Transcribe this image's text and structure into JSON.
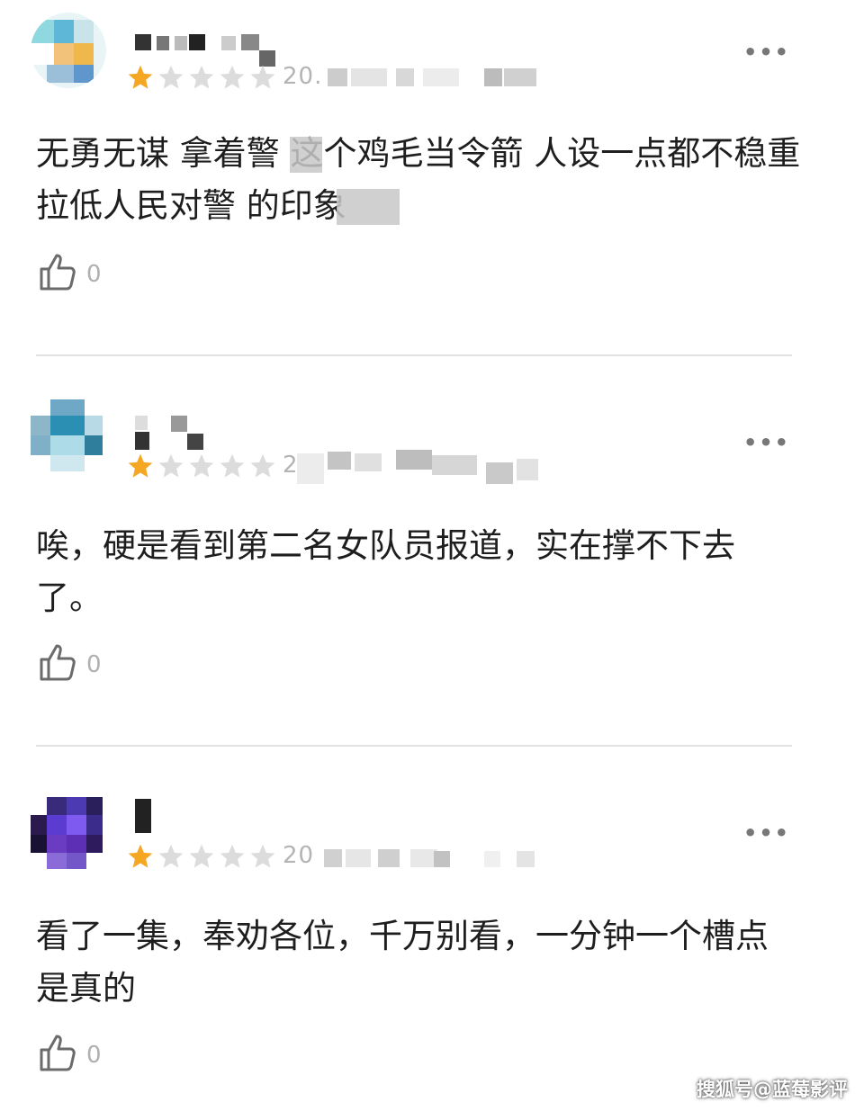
{
  "reviews": [
    {
      "rating": 1,
      "date_prefix": "20.",
      "content": "无勇无谋 拿着警  这个鸡毛当令箭 人设一点都不稳重 拉低人民对警  的印象",
      "likes": "0",
      "more": "•••"
    },
    {
      "rating": 1,
      "date_prefix": "2",
      "content": "唉，硬是看到第二名女队员报道，实在撑不下去了。",
      "likes": "0",
      "more": "•••"
    },
    {
      "rating": 1,
      "date_prefix": "20",
      "content": "看了一集，奉劝各位，千万别看，一分钟一个槽点是真的",
      "likes": "0",
      "more": "•••"
    }
  ],
  "watermark": "搜狐号@蓝莓影评",
  "colors": {
    "star_filled": "#f5a623",
    "star_empty": "#dcdcdc",
    "divider": "#e2e2e2"
  }
}
